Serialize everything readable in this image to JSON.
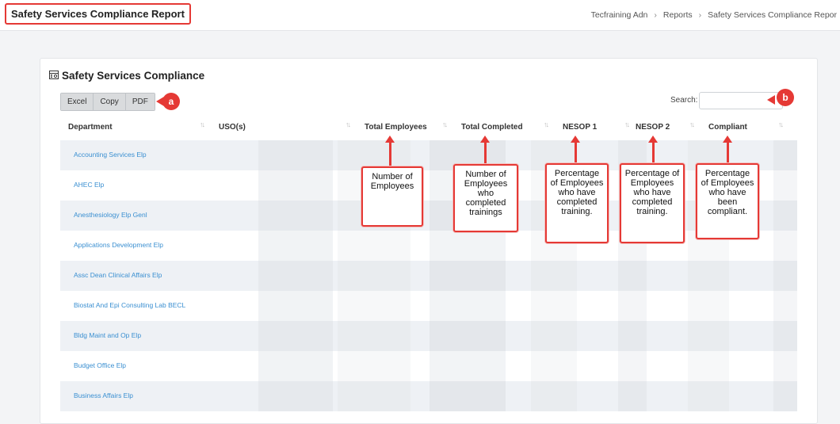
{
  "header": {
    "page_title": "Safety Services Compliance Report",
    "breadcrumbs": [
      "Tecfraining Adn",
      "Reports",
      "Safety Services Compliance Repor"
    ],
    "separator": "›"
  },
  "card": {
    "title": "Safety Services Compliance",
    "buttons": [
      "Excel",
      "Copy",
      "PDF"
    ],
    "search_label": "Search:",
    "search_value": ""
  },
  "callouts": {
    "a": "a",
    "b": "b"
  },
  "table": {
    "columns": [
      "Department",
      "USO(s)",
      "Total Employees",
      "Total Completed",
      "NESOP 1",
      "NESOP 2",
      "Compliant"
    ],
    "rows": [
      "Accounting Services Elp",
      "AHEC Elp",
      "Anesthesiology Elp Genl",
      "Applications Development Elp",
      "Assc Dean Clinical Affairs Elp",
      "Biostat And Epi Consulting Lab BECL",
      "Bldg Maint and Op Elp",
      "Budget Office Elp",
      "Business Affairs Elp"
    ]
  },
  "annotations": [
    "Number of Employees",
    "Number of Employees who completed trainings",
    "Percentage of Employees who have completed training.",
    "Percentage of Employees who have completed training.",
    "Percentage of Employees who have been compliant."
  ],
  "colors": {
    "accent": "#e53935",
    "link": "#3a8fd1",
    "row_alt": "#eef1f5"
  }
}
